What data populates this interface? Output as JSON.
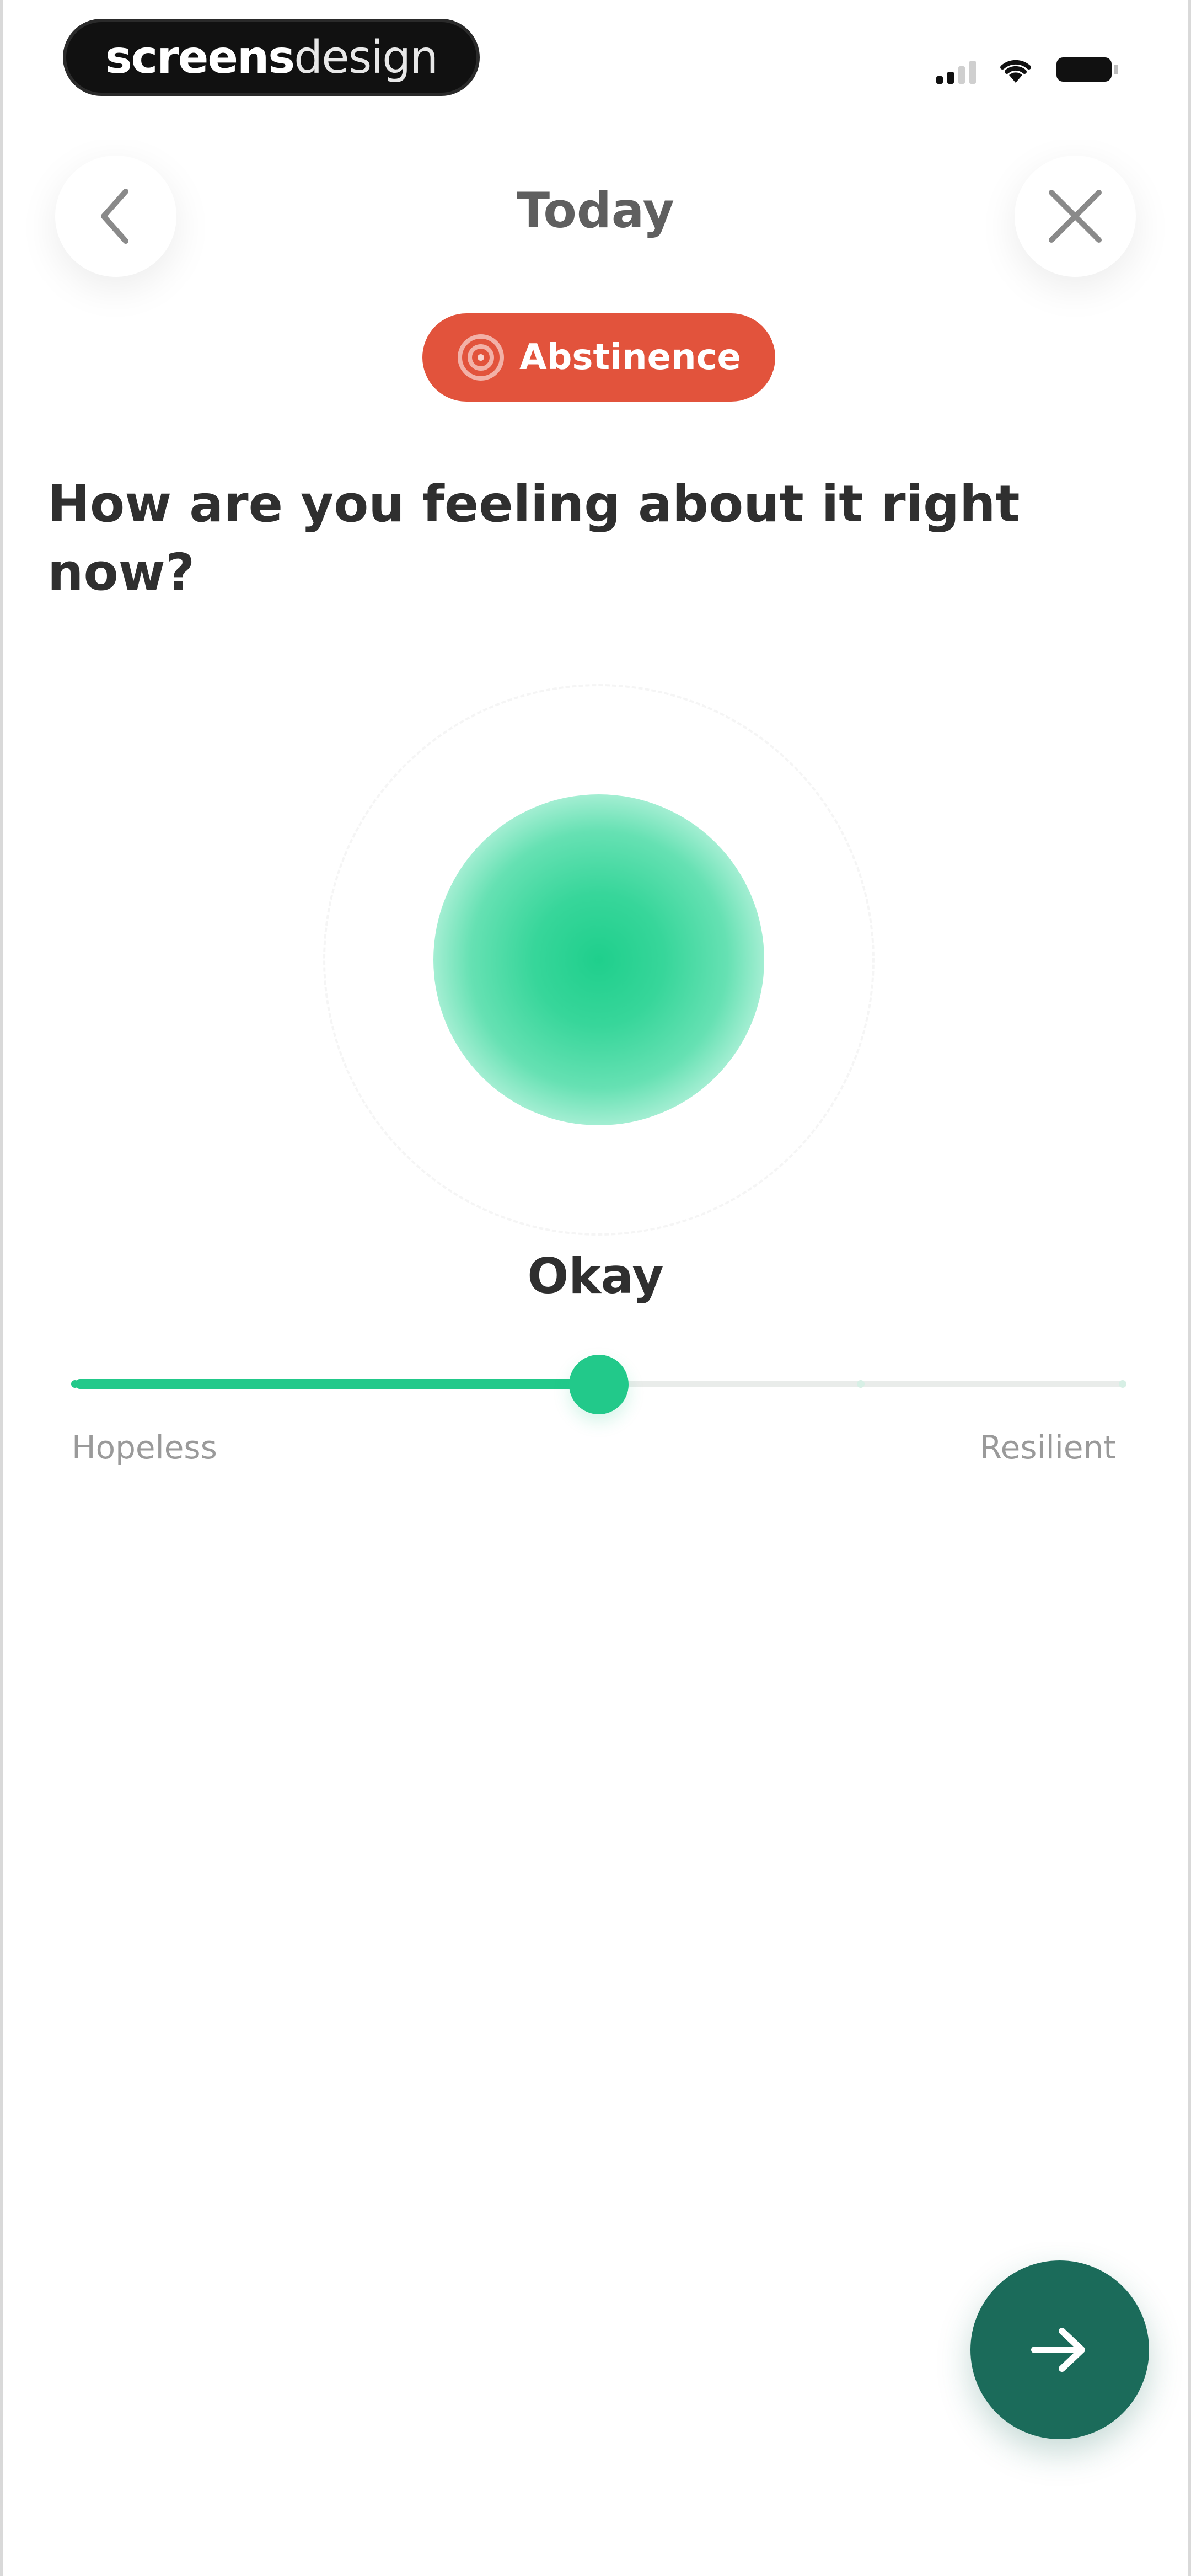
{
  "status_bar": {
    "brand_bold": "screens",
    "brand_light": "design"
  },
  "header": {
    "title": "Today",
    "back_icon": "chevron-left-icon",
    "close_icon": "close-icon"
  },
  "badge": {
    "label": "Abstinence",
    "icon": "target-icon",
    "color": "#e2533c"
  },
  "question": "How are you feeling about it right now?",
  "mood": {
    "label": "Okay",
    "orb_color": "#22c98a"
  },
  "slider": {
    "min_label": "Hopeless",
    "max_label": "Resilient",
    "value": 0.5,
    "steps": 5,
    "accent": "#22c98a"
  },
  "next_button": {
    "icon": "arrow-right-icon",
    "color": "#1b6b5a"
  }
}
